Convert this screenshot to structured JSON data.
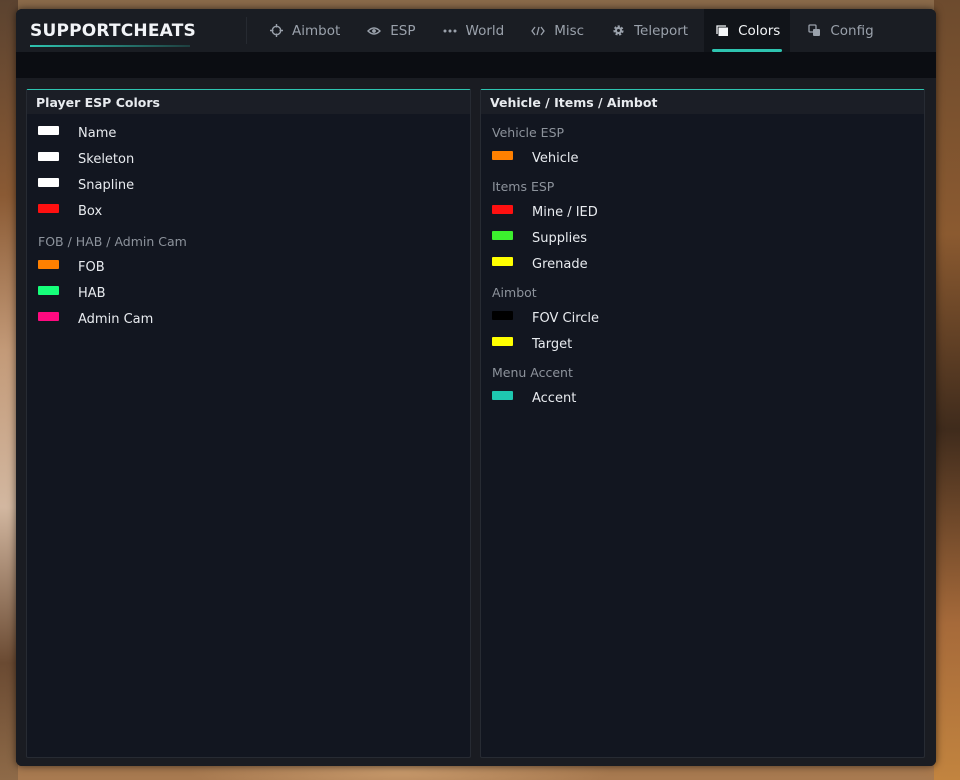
{
  "brand": "SUPPORTCHEATS",
  "tabs": [
    {
      "label": "Aimbot",
      "icon": "crosshair-icon"
    },
    {
      "label": "ESP",
      "icon": "eye-icon"
    },
    {
      "label": "World",
      "icon": "dots-icon"
    },
    {
      "label": "Misc",
      "icon": "code-icon"
    },
    {
      "label": "Teleport",
      "icon": "gear-icon"
    },
    {
      "label": "Colors",
      "icon": "window-icon",
      "active": true
    },
    {
      "label": "Config",
      "icon": "copy-icon"
    }
  ],
  "left_panel": {
    "title": "Player ESP Colors",
    "groups": [
      {
        "label": "",
        "items": [
          {
            "label": "Name",
            "color": "#ffffff"
          },
          {
            "label": "Skeleton",
            "color": "#ffffff"
          },
          {
            "label": "Snapline",
            "color": "#ffffff"
          },
          {
            "label": "Box",
            "color": "#ff1010"
          }
        ]
      },
      {
        "label": "FOB / HAB / Admin Cam",
        "items": [
          {
            "label": "FOB",
            "color": "#ff8000"
          },
          {
            "label": "HAB",
            "color": "#16ff7a"
          },
          {
            "label": "Admin Cam",
            "color": "#ff0a80"
          }
        ]
      }
    ]
  },
  "right_panel": {
    "title": "Vehicle / Items / Aimbot",
    "groups": [
      {
        "label": "Vehicle ESP",
        "items": [
          {
            "label": "Vehicle",
            "color": "#ff8000"
          }
        ]
      },
      {
        "label": "Items ESP",
        "items": [
          {
            "label": "Mine / IED",
            "color": "#ff1010"
          },
          {
            "label": "Supplies",
            "color": "#3cf02e"
          },
          {
            "label": "Grenade",
            "color": "#ffff00"
          }
        ]
      },
      {
        "label": "Aimbot",
        "items": [
          {
            "label": "FOV Circle",
            "color": "#000000"
          },
          {
            "label": "Target",
            "color": "#ffff00"
          }
        ]
      },
      {
        "label": "Menu Accent",
        "items": [
          {
            "label": "Accent",
            "color": "#1ec8b0"
          }
        ]
      }
    ]
  },
  "accent_color": "#2ec4b0"
}
